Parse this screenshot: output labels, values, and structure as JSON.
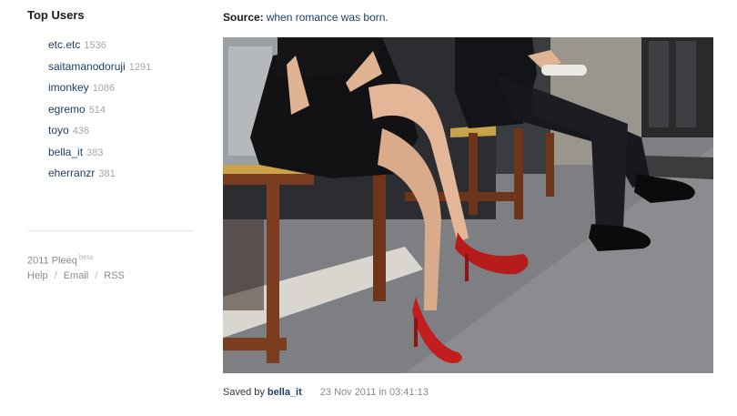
{
  "sidebar": {
    "heading": "Top Users",
    "users": [
      {
        "name": "etc.etc",
        "count": "1536"
      },
      {
        "name": "saitamanodoruji",
        "count": "1291"
      },
      {
        "name": "imonkey",
        "count": "1086"
      },
      {
        "name": "egremo",
        "count": "514"
      },
      {
        "name": "toyo",
        "count": "436"
      },
      {
        "name": "bella_it",
        "count": "383"
      },
      {
        "name": "eherranzr",
        "count": "381"
      }
    ],
    "copyright": "2011 Pleeq",
    "beta": "beta",
    "links": [
      {
        "label": "Help"
      },
      {
        "label": "Email"
      },
      {
        "label": "RSS"
      }
    ],
    "link_separator": "/"
  },
  "main": {
    "source_label": "Source:",
    "source_text": "when romance was born.",
    "photo": {
      "name": "photo-woman-red-heels-man-suit-bench"
    },
    "caption": {
      "saved_by_label": "Saved by",
      "saved_by_user": "bella_it",
      "timestamp": "23 Nov 2011 in 03:41:13"
    }
  },
  "colors": {
    "link": "#1e3f6b",
    "muted_count": "#a7a7a7",
    "footer_text": "#8b8b8b",
    "divider": "#e4e4e4"
  }
}
